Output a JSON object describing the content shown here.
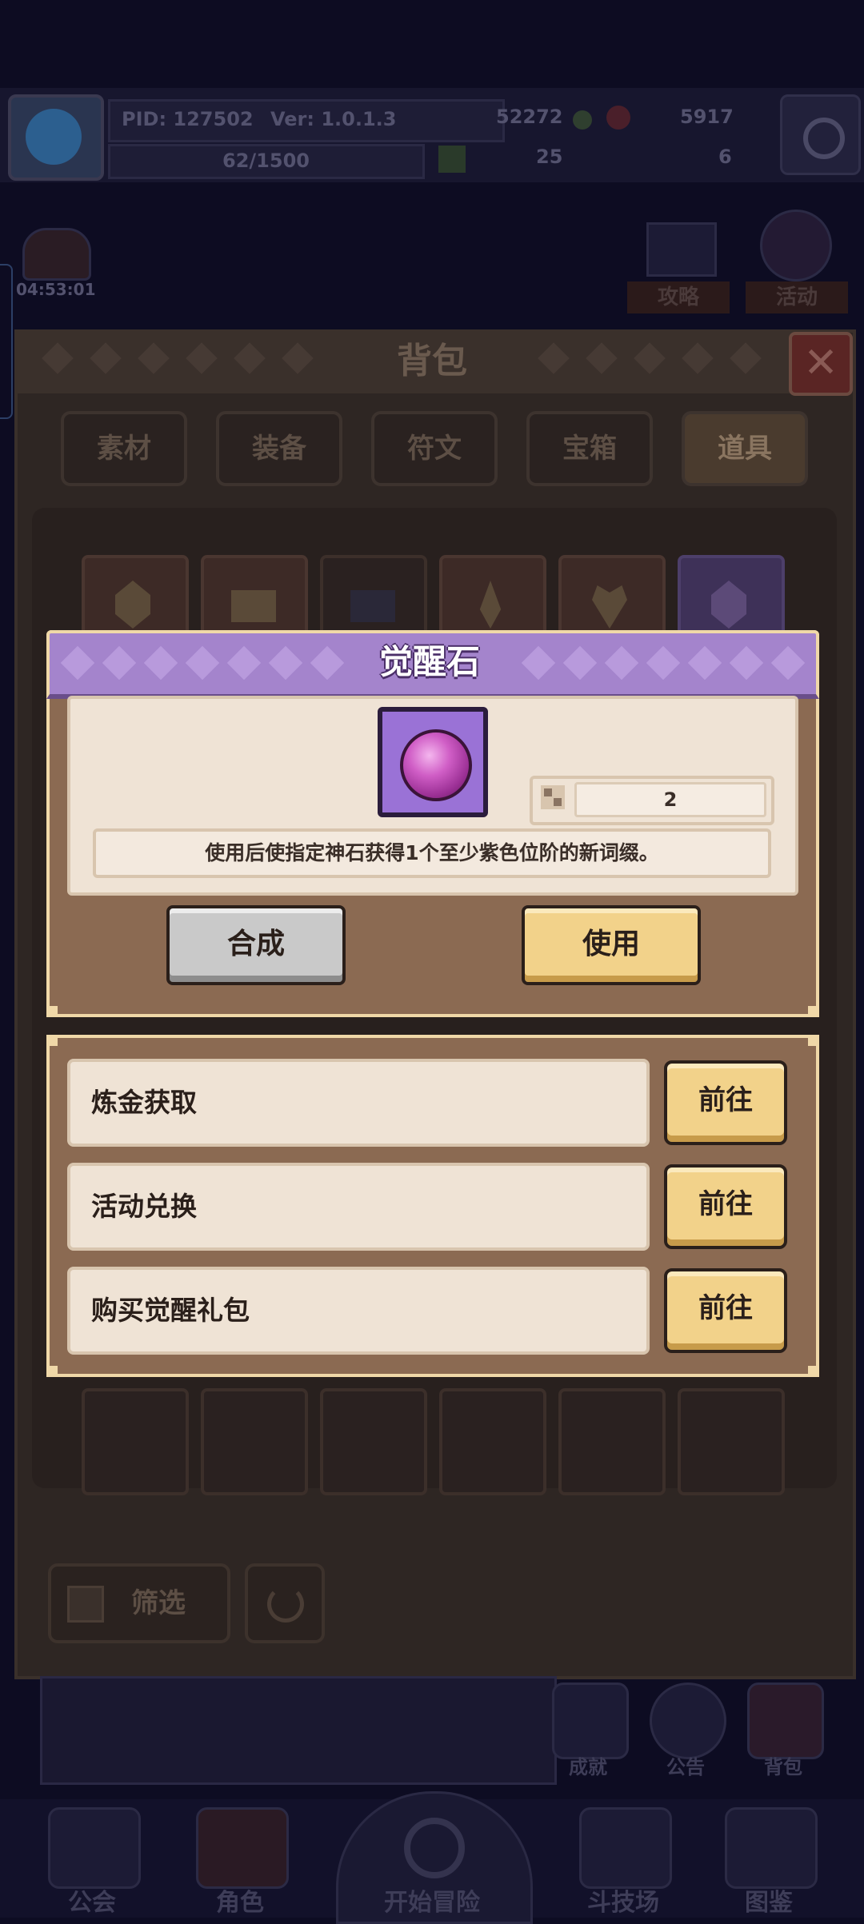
{
  "header": {
    "pid": "PID: 127502",
    "version": "Ver: 1.0.1.3",
    "coins": "52272",
    "gems": "5917",
    "xp": "62/1500",
    "stat_a": "25",
    "stat_b": "6"
  },
  "side": {
    "timer": "04:53:01",
    "guide_label": "攻略",
    "event_label": "活动"
  },
  "backpack": {
    "title": "背包",
    "close_glyph": "✕",
    "tabs": [
      "素材",
      "装备",
      "符文",
      "宝箱",
      "道具"
    ],
    "active_tab": "道具",
    "filter_label": "筛选"
  },
  "item_dialog": {
    "title": "觉醒石",
    "count": "2",
    "description": "使用后使指定神石获得1个至少紫色位阶的新词缀。",
    "synth_button": "合成",
    "use_button": "使用"
  },
  "sources": [
    {
      "label": "炼金获取",
      "button": "前往"
    },
    {
      "label": "活动兑换",
      "button": "前往"
    },
    {
      "label": "购买觉醒礼包",
      "button": "前往"
    }
  ],
  "bottom_nav": {
    "achievements": "成就",
    "notice": "公告",
    "bag": "背包",
    "guild": "公会",
    "character": "角色",
    "start": "开始冒险",
    "arena": "斗技场",
    "codex": "图鉴"
  },
  "colors": {
    "dialog_header": "#a484cc",
    "dialog_body": "#8b6a52",
    "gold_button": "#f2d28a",
    "gray_button": "#c9c9c9"
  }
}
